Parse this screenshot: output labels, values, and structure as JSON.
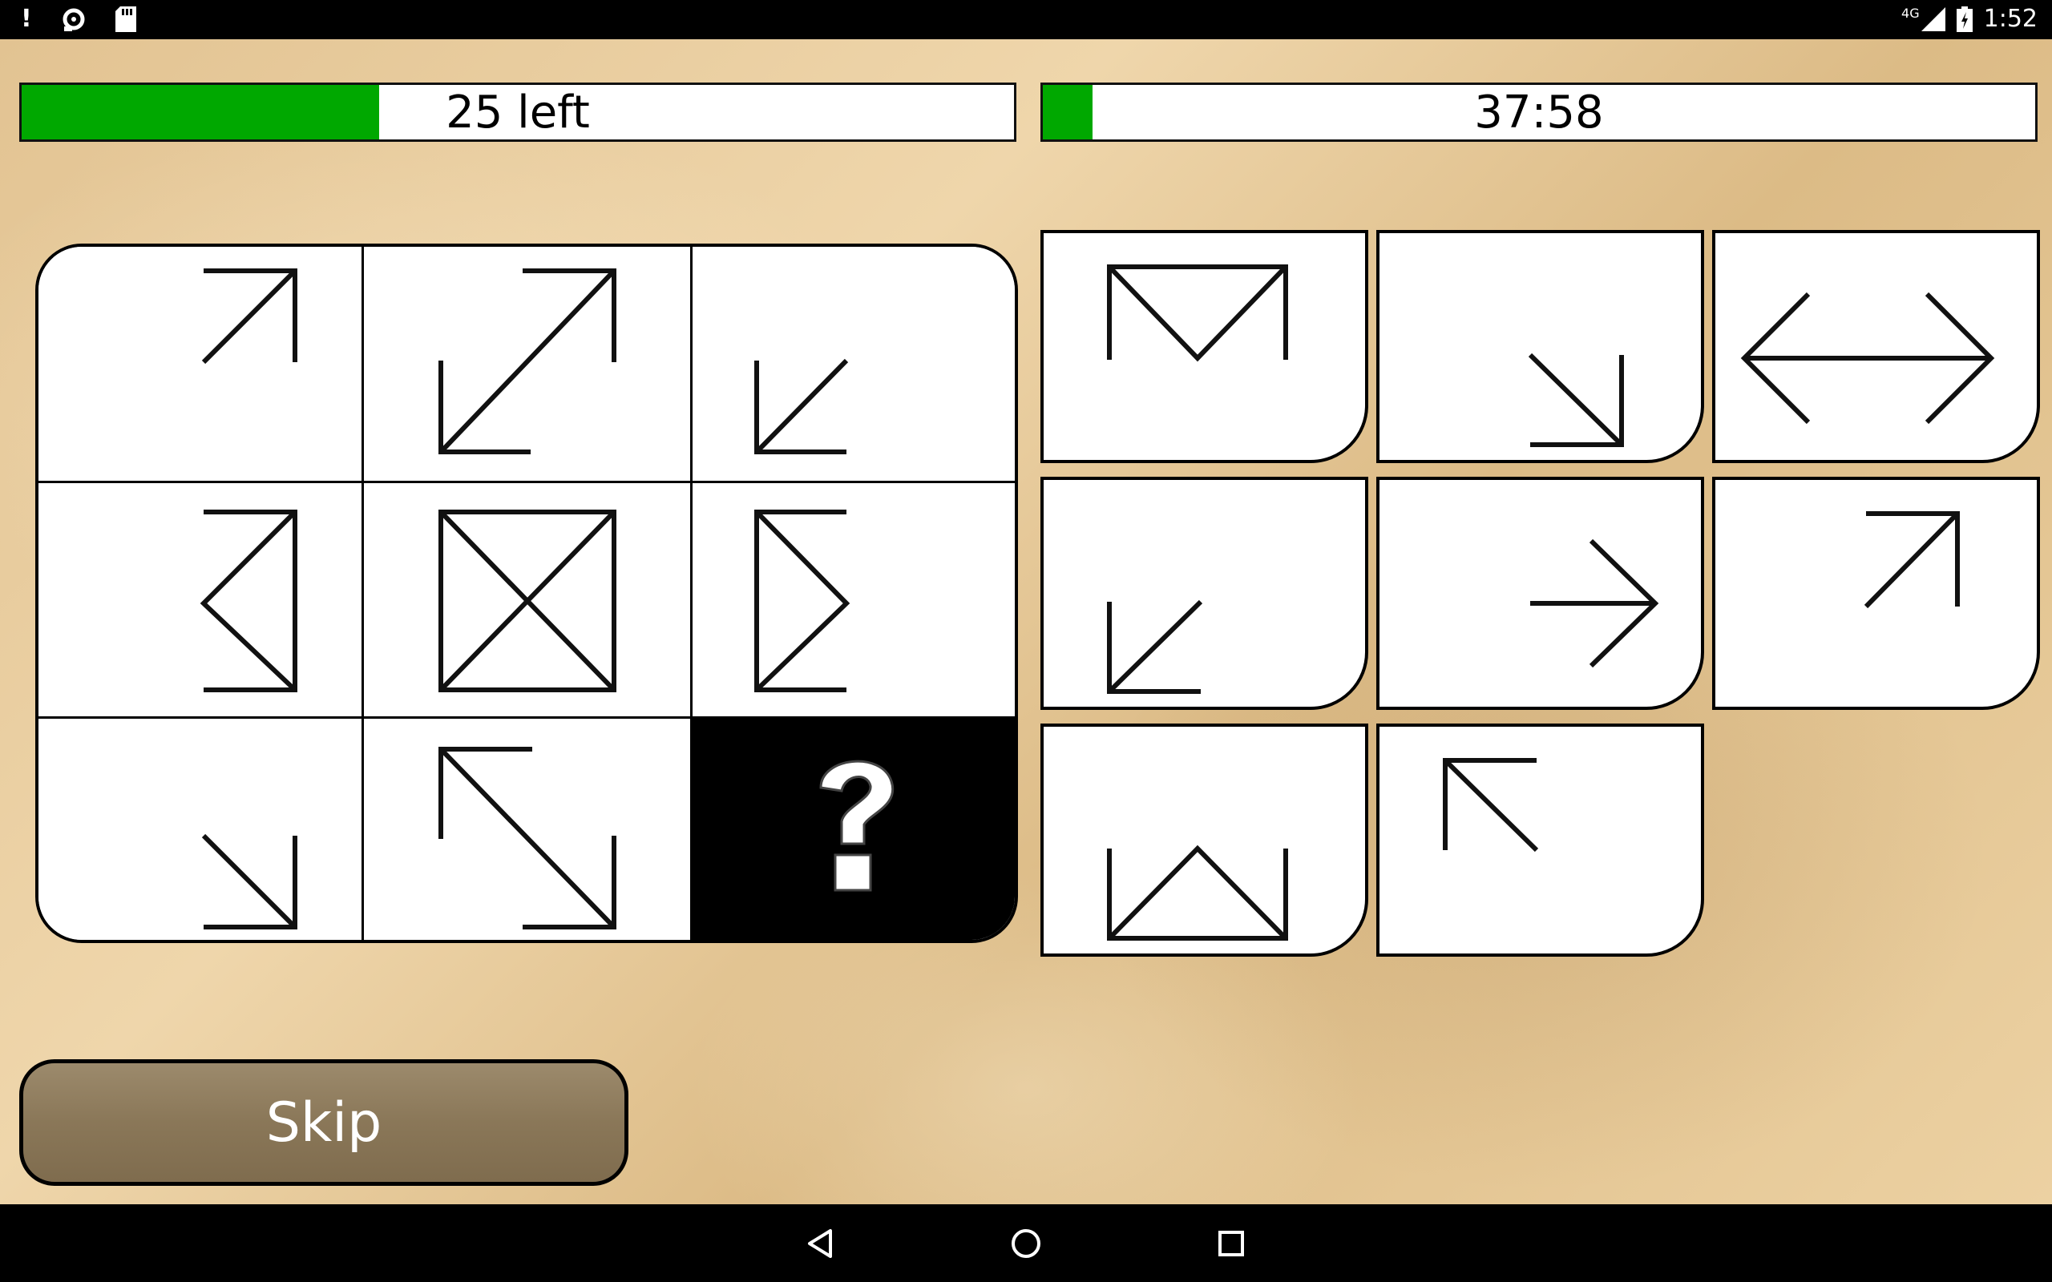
{
  "status_bar": {
    "time": "1:52",
    "network": "4G",
    "left_icons": [
      "alert-icon",
      "sync-icon",
      "sd-card-icon"
    ],
    "right_icons": [
      "signal-icon",
      "battery-icon"
    ]
  },
  "progress": {
    "remaining_text": "25 left",
    "remaining_fraction": 0.36,
    "timer_text": "37:58",
    "timer_fraction": 0.05,
    "fill_color": "#00a800"
  },
  "puzzle": {
    "cells": [
      {
        "row": 1,
        "col": 1,
        "figure": "arrow-up-right"
      },
      {
        "row": 1,
        "col": 2,
        "figure": "double-arrow-diagonal-ne-sw"
      },
      {
        "row": 1,
        "col": 3,
        "figure": "arrow-down-left"
      },
      {
        "row": 2,
        "col": 1,
        "figure": "triangle-pointing-left"
      },
      {
        "row": 2,
        "col": 2,
        "figure": "square-with-x"
      },
      {
        "row": 2,
        "col": 3,
        "figure": "triangle-pointing-right"
      },
      {
        "row": 3,
        "col": 1,
        "figure": "arrow-down-right"
      },
      {
        "row": 3,
        "col": 2,
        "figure": "double-arrow-diagonal-nw-se"
      },
      {
        "row": 3,
        "col": 3,
        "figure": "question-mark"
      }
    ]
  },
  "options": [
    {
      "figure": "envelope-m"
    },
    {
      "figure": "arrow-down-right"
    },
    {
      "figure": "double-arrow-horizontal"
    },
    {
      "figure": "arrow-down-left"
    },
    {
      "figure": "arrow-right"
    },
    {
      "figure": "arrow-up-right"
    },
    {
      "figure": "envelope-w"
    },
    {
      "figure": "arrow-up-left"
    }
  ],
  "skip_button": {
    "label": "Skip"
  },
  "nav_bar": {
    "buttons": [
      "back-icon",
      "home-icon",
      "recents-icon"
    ]
  }
}
